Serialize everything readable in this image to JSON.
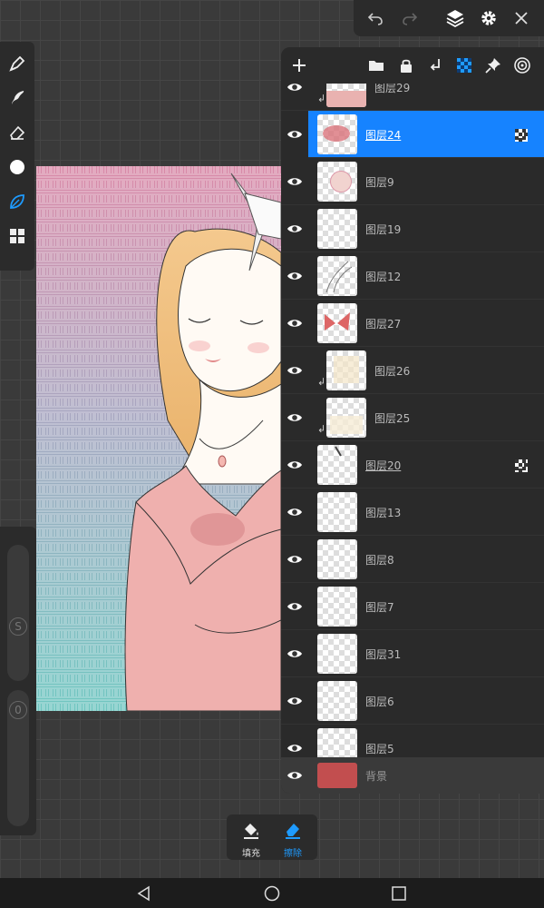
{
  "top_toolbar": {
    "icons": [
      "undo-icon",
      "redo-icon",
      "layers-icon",
      "gear-icon",
      "close-icon"
    ]
  },
  "left_tools": {
    "icons": [
      "brush-icon",
      "smudge-icon",
      "eraser-icon",
      "color-dot-icon",
      "leaf-brush-icon",
      "gallery-grid-icon"
    ]
  },
  "side_sliders": {
    "size_label": "S",
    "opacity_label": "0"
  },
  "layer_panel": {
    "header_icons": [
      "add-icon",
      "folder-icon",
      "lock-icon",
      "merge-down-icon",
      "checker-icon",
      "pin-icon",
      "target-icon"
    ],
    "layers": [
      {
        "name": "图层29",
        "clipped": true
      },
      {
        "name": "图层24",
        "selected": true,
        "alpha_lock": true
      },
      {
        "name": "图层9"
      },
      {
        "name": "图层19"
      },
      {
        "name": "图层12"
      },
      {
        "name": "图层27"
      },
      {
        "name": "图层26",
        "clipped": true
      },
      {
        "name": "图层25",
        "clipped": true
      },
      {
        "name": "图层20",
        "alpha_lock": true
      },
      {
        "name": "图层13"
      },
      {
        "name": "图层8"
      },
      {
        "name": "图层7"
      },
      {
        "name": "图层31"
      },
      {
        "name": "图层6"
      },
      {
        "name": "图层5"
      }
    ],
    "background": {
      "name": "背景",
      "color": "#c24e4f"
    }
  },
  "fill_erase": {
    "fill_label": "填充",
    "erase_label": "擦除",
    "active_color": "#1e9bff"
  },
  "nav_bar": {
    "icons": [
      "back-icon",
      "home-icon",
      "recents-icon"
    ]
  }
}
